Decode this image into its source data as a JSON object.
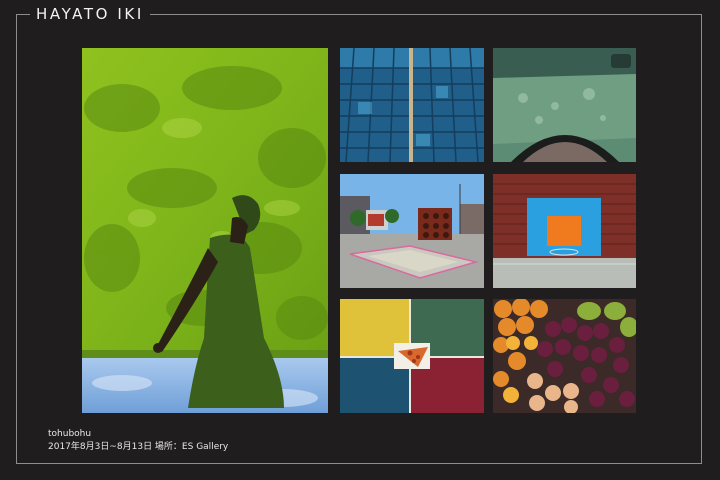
{
  "header": {
    "brand": "HAYATO IKI"
  },
  "exhibition": {
    "title": "tohubohu",
    "details": "2017年8月3日~8月13日 場所：ES Gallery"
  },
  "photos": [
    {
      "id": "woman-green-wall"
    },
    {
      "id": "blue-roof"
    },
    {
      "id": "green-truck"
    },
    {
      "id": "street-speakers"
    },
    {
      "id": "basketball-court"
    },
    {
      "id": "pizza-slice"
    },
    {
      "id": "fruit-stand"
    }
  ]
}
